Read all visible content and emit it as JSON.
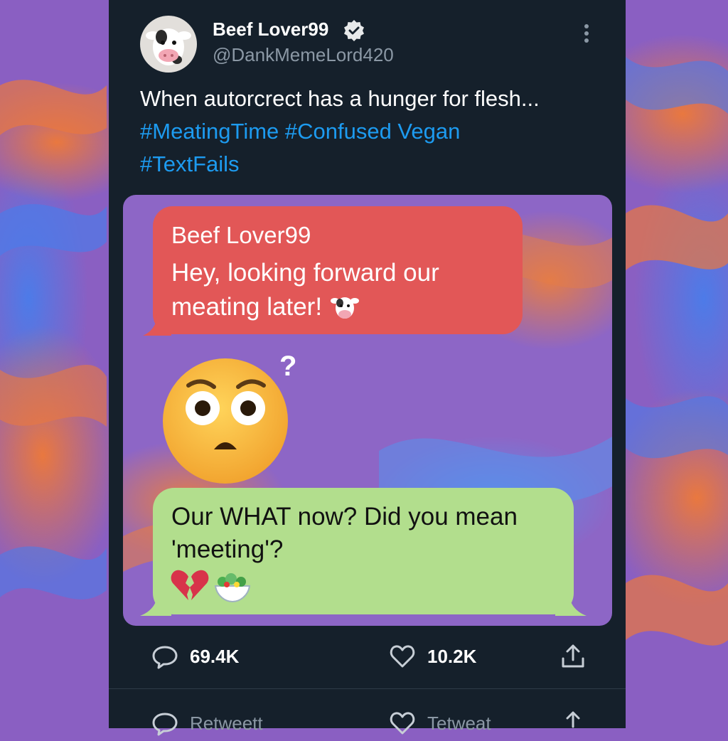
{
  "post": {
    "display_name": "Beef Lover99",
    "handle": "@DankMemeLord420",
    "text": "When autorcrect has a hunger for flesh...",
    "hashtags_line1": "#MeatingTime #Confused Vegan",
    "hashtags_line2": "#TextFails"
  },
  "media": {
    "sender_name": "Beef Lover99",
    "message_sent": "Hey, looking forward our meating later!",
    "message_reply": "Our WHAT now? Did you mean 'meeting'?"
  },
  "actions": {
    "reply_count": "69.4K",
    "like_count": "10.2K",
    "retweet_label": "Retweett",
    "tetweat_label": "Tetweat"
  },
  "colors": {
    "card_bg": "#15202b",
    "hashtag": "#1d9bf0",
    "sent_bubble": "#e25757",
    "reply_bubble": "#b2de8d"
  },
  "icons": [
    "cow-avatar-icon",
    "verified-icon",
    "more-icon",
    "cow-emoji-icon",
    "flushed-face-icon",
    "broken-heart-icon",
    "salad-icon",
    "reply-icon",
    "like-icon",
    "share-icon"
  ]
}
